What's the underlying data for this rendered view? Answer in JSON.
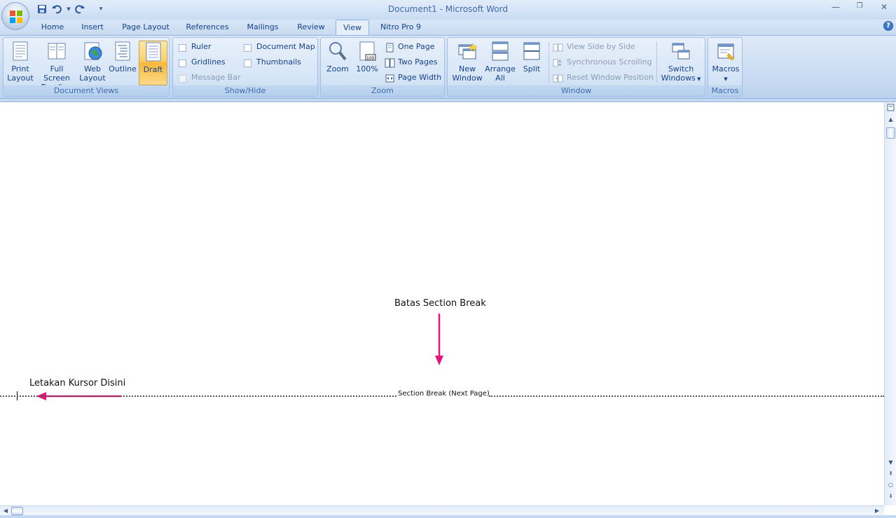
{
  "window": {
    "title": "Document1 - Microsoft Word"
  },
  "tabs": [
    "Home",
    "Insert",
    "Page Layout",
    "References",
    "Mailings",
    "Review",
    "View",
    "Nitro Pro 9"
  ],
  "active_tab": "View",
  "ribbon": {
    "document_views": {
      "label": "Document Views",
      "buttons": [
        {
          "line1": "Print",
          "line2": "Layout"
        },
        {
          "line1": "Full Screen",
          "line2": "Reading"
        },
        {
          "line1": "Web",
          "line2": "Layout"
        },
        {
          "line1": "Outline",
          "line2": ""
        },
        {
          "line1": "Draft",
          "line2": ""
        }
      ]
    },
    "show_hide": {
      "label": "Show/Hide",
      "ruler": "Ruler",
      "gridlines": "Gridlines",
      "message_bar": "Message Bar",
      "document_map": "Document Map",
      "thumbnails": "Thumbnails"
    },
    "zoom": {
      "label": "Zoom",
      "zoom_btn": "Zoom",
      "zoom100_btn": "100%",
      "one_page": "One Page",
      "two_pages": "Two Pages",
      "page_width": "Page Width"
    },
    "window": {
      "label": "Window",
      "new_window": {
        "line1": "New",
        "line2": "Window"
      },
      "arrange_all": {
        "line1": "Arrange",
        "line2": "All"
      },
      "split": "Split",
      "view_side_by_side": "View Side by Side",
      "synchronous_scrolling": "Synchronous Scrolling",
      "reset_window_position": "Reset Window Position",
      "switch_windows": {
        "line1": "Switch",
        "line2": "Windows"
      }
    },
    "macros": {
      "label": "Macros",
      "button": "Macros"
    }
  },
  "document": {
    "annotation_top": "Batas Section Break",
    "annotation_left": "Letakan Kursor Disini",
    "section_break": "Section Break (Next Page)"
  },
  "colors": {
    "annotation_arrow": "#e8147a",
    "active_button": "#fbd06f"
  }
}
